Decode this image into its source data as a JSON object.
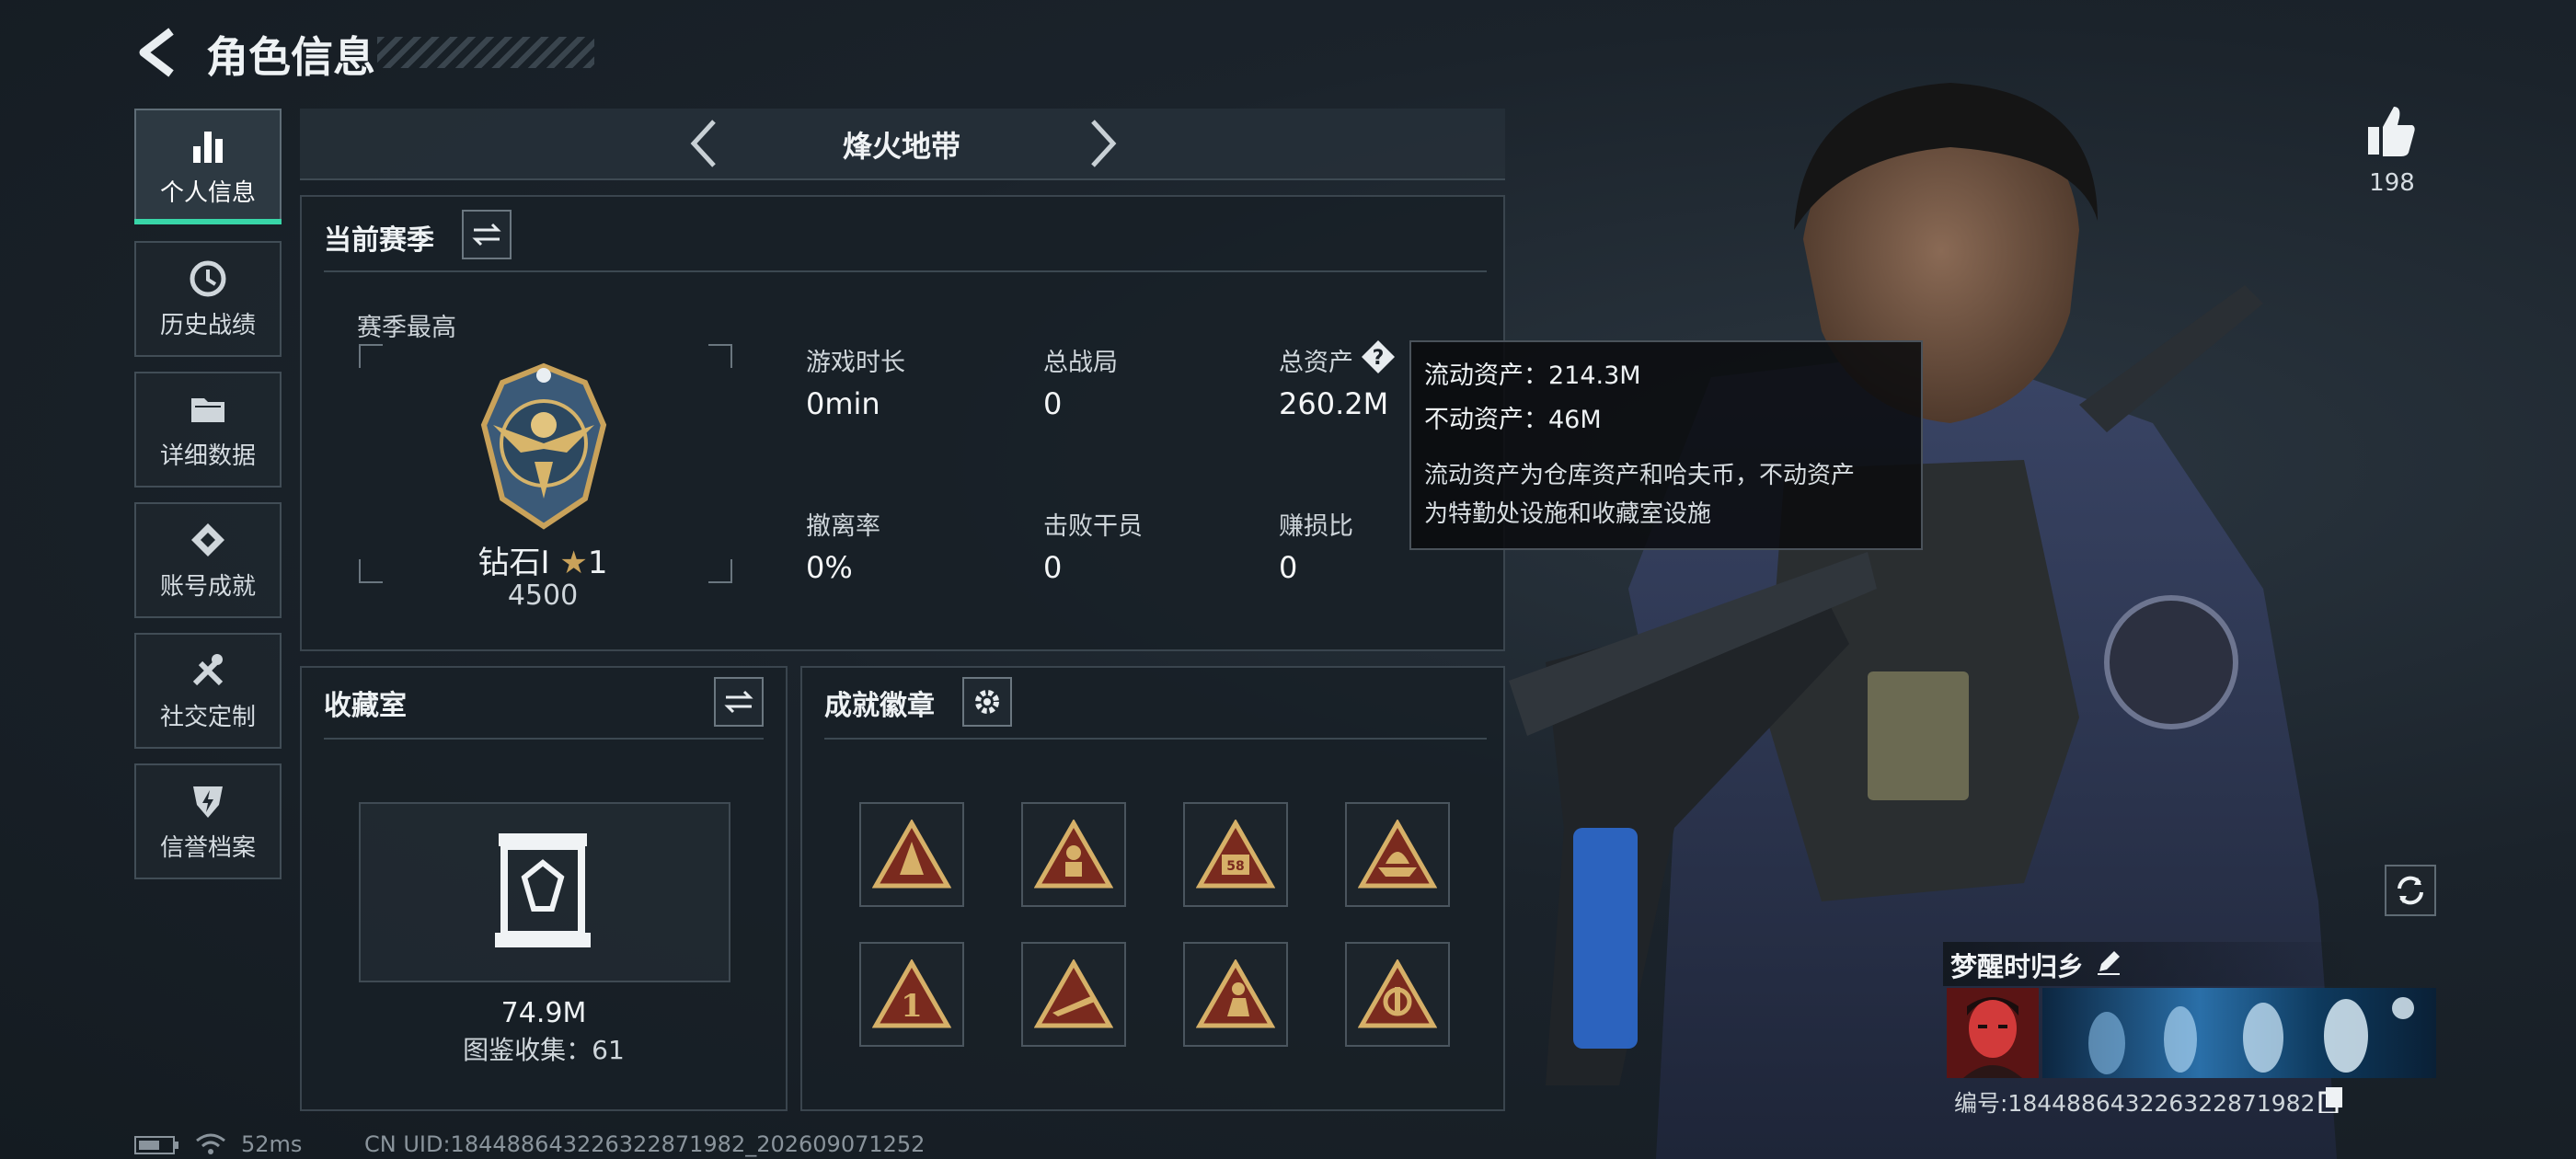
{
  "header": {
    "title": "角色信息"
  },
  "sidebar": {
    "items": [
      {
        "label": "个人信息",
        "icon": "bar-chart-icon",
        "active": true
      },
      {
        "label": "历史战绩",
        "icon": "clock-icon",
        "active": false
      },
      {
        "label": "详细数据",
        "icon": "folder-icon",
        "active": false
      },
      {
        "label": "账号成就",
        "icon": "achievement-icon",
        "active": false
      },
      {
        "label": "社交定制",
        "icon": "tools-icon",
        "active": false
      },
      {
        "label": "信誉档案",
        "icon": "shield-bolt-icon",
        "active": false
      }
    ]
  },
  "mode_selector": {
    "label": "烽火地带"
  },
  "season": {
    "title": "当前赛季",
    "best_label": "赛季最高",
    "rank_name": "钻石I",
    "rank_stars": "1",
    "rank_score": "4500",
    "stats": [
      {
        "label": "游戏时长",
        "value": "0min"
      },
      {
        "label": "总战局",
        "value": "0"
      },
      {
        "label": "总资产",
        "value": "260.2M"
      },
      {
        "label": "撤离率",
        "value": "0%"
      },
      {
        "label": "击败干员",
        "value": "0"
      },
      {
        "label": "赚损比",
        "value": "0"
      }
    ]
  },
  "tooltip": {
    "line1": "流动资产：214.3M",
    "line2": "不动资产：46M",
    "desc1": "流动资产为仓库资产和哈夫币，不动资产",
    "desc2": "为特勤处设施和收藏室设施"
  },
  "collection": {
    "title": "收藏室",
    "value": "74.9M",
    "count_label": "图鉴收集：61"
  },
  "achievements": {
    "title": "成就徽章",
    "badges": [
      "badge-cone-icon",
      "badge-soldier-icon",
      "badge-58-icon",
      "badge-boat-icon",
      "badge-number-one-icon",
      "badge-prone-icon",
      "badge-kneel-icon",
      "badge-cross-icon"
    ]
  },
  "likes": {
    "count": "198"
  },
  "profile": {
    "name": "梦醒时归乡",
    "id_label": "编号:184488643226322871982"
  },
  "status_bar": {
    "ping": "52ms",
    "uid": "CN UID:184488643226322871982_202609071252"
  },
  "colors": {
    "accent_green": "#38d6a8",
    "gold": "#c9a25a",
    "panel_bg": "#182027"
  }
}
